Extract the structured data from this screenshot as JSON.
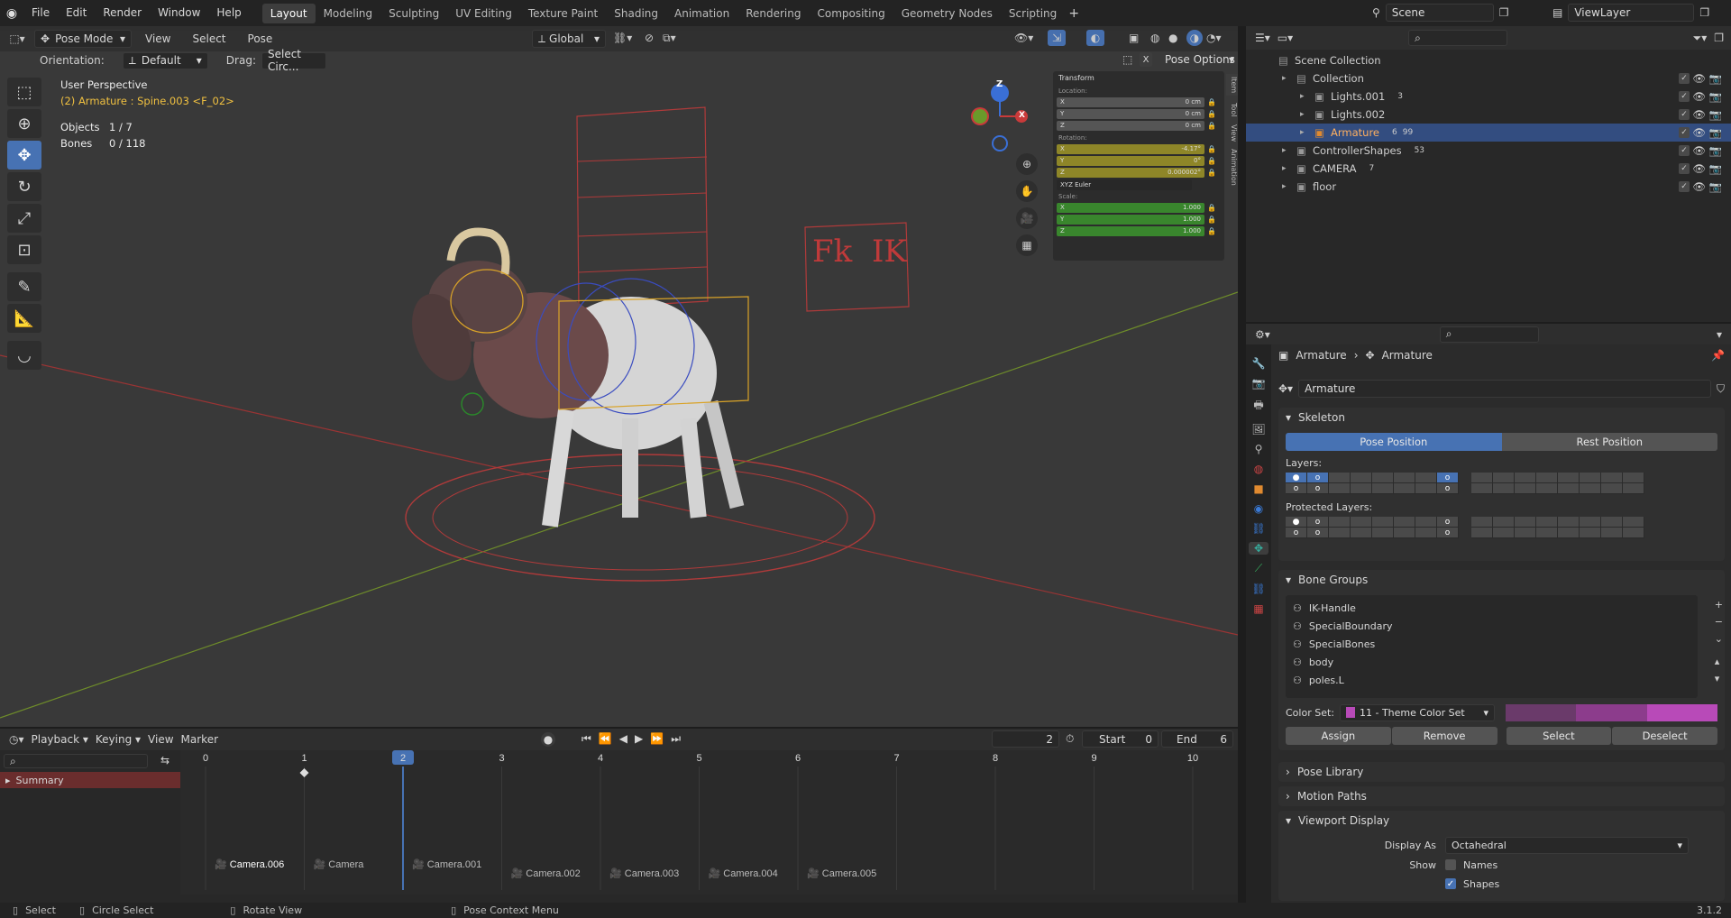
{
  "menubar": {
    "items": [
      "File",
      "Edit",
      "Render",
      "Window",
      "Help"
    ],
    "workspaces": [
      "Layout",
      "Modeling",
      "Sculpting",
      "UV Editing",
      "Texture Paint",
      "Shading",
      "Animation",
      "Rendering",
      "Compositing",
      "Geometry Nodes",
      "Scripting"
    ],
    "active_workspace": "Layout",
    "scene": "Scene",
    "view_layer": "ViewLayer"
  },
  "viewport": {
    "mode": "Pose Mode",
    "menus": [
      "View",
      "Select",
      "Pose"
    ],
    "transform_orientation": "Global",
    "orientation_label": "Orientation:",
    "orientation_value": "Default",
    "drag_label": "Drag:",
    "drag_value": "Select Circ...",
    "pose_options": "Pose Options",
    "x_button": "X",
    "view_name": "User Perspective",
    "active": "(2) Armature : Spine.003 <F_02>",
    "objects_label": "Objects",
    "objects_value": "1 / 7",
    "bones_label": "Bones",
    "bones_value": "0 / 118",
    "gizmo_axes": [
      "X",
      "Y",
      "Z"
    ],
    "overlay_text": [
      "Fk",
      "IK"
    ],
    "side_tabs": [
      "Item",
      "Tool",
      "View",
      "Animation"
    ]
  },
  "npanel": {
    "title": "Transform",
    "location_label": "Location:",
    "location": [
      "0 cm",
      "0 cm",
      "0 cm"
    ],
    "rotation_label": "Rotation:",
    "rotation": [
      "-4.17°",
      "0°",
      "0.000002°"
    ],
    "rotation_mode": "XYZ Euler",
    "scale_label": "Scale:",
    "scale": [
      "1.000",
      "1.000",
      "1.000"
    ],
    "axis": [
      "X",
      "Y",
      "Z"
    ],
    "colors": {
      "location": "#555555",
      "rotation": "#8e8628",
      "scale": "#39862d"
    }
  },
  "outliner": {
    "search_placeholder": "",
    "rows": [
      {
        "label": "Scene Collection",
        "indent": 0
      },
      {
        "label": "Collection",
        "indent": 1
      },
      {
        "label": "Lights.001",
        "indent": 2,
        "badge": "3"
      },
      {
        "label": "Lights.002",
        "indent": 2
      },
      {
        "label": "Armature",
        "indent": 2,
        "selected": true,
        "badge": "6",
        "badge2": "99"
      },
      {
        "label": "ControllerShapes",
        "indent": 1,
        "badge": "53"
      },
      {
        "label": "CAMERA",
        "indent": 1,
        "badge": "7"
      },
      {
        "label": "floor",
        "indent": 1
      }
    ]
  },
  "properties": {
    "breadcrumb": [
      "Armature",
      "Armature"
    ],
    "data_name": "Armature",
    "skeleton": {
      "title": "Skeleton",
      "pose_position": "Pose Position",
      "rest_position": "Rest Position",
      "layers": "Layers:",
      "protected": "Protected Layers:"
    },
    "bone_groups": {
      "title": "Bone Groups",
      "items": [
        "IK-Handle",
        "SpecialBoundary",
        "SpecialBones",
        "body",
        "poles.L"
      ],
      "color_set_label": "Color Set:",
      "color_set": "11 - Theme Color Set",
      "colors": [
        "#6a3a6a",
        "#8c3c8c",
        "#b84ab8"
      ],
      "buttons": [
        "Assign",
        "Remove",
        "Select",
        "Deselect"
      ]
    },
    "collapsed": [
      "Pose Library",
      "Motion Paths"
    ],
    "viewport_display": {
      "title": "Viewport Display",
      "display_as_label": "Display As",
      "display_as": "Octahedral",
      "show_label": "Show",
      "names": "Names",
      "shapes": "Shapes"
    }
  },
  "timeline": {
    "menus": [
      "Playback",
      "Keying",
      "View",
      "Marker"
    ],
    "current_frame": "2",
    "start_label": "Start",
    "start": "0",
    "end_label": "End",
    "end": "6",
    "frames": [
      "0",
      "1",
      "2",
      "3",
      "4",
      "5",
      "6",
      "7",
      "8",
      "9",
      "10"
    ],
    "summary": "Summary",
    "markers": [
      "Camera.006",
      "Camera",
      "Camera.001",
      "Camera.002",
      "Camera.003",
      "Camera.004",
      "Camera.005"
    ]
  },
  "status": {
    "select": "Select",
    "circle_select": "Circle Select",
    "rotate_view": "Rotate View",
    "context_menu": "Pose Context Menu",
    "version": "3.1.2"
  }
}
